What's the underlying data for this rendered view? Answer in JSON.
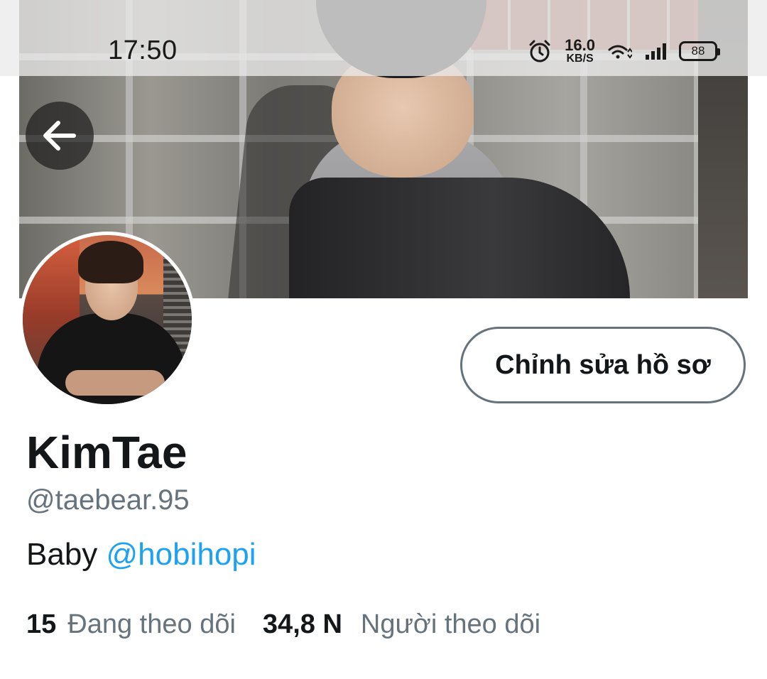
{
  "status_bar": {
    "time": "17:50",
    "net_speed_value": "16.0",
    "net_speed_unit": "KB/S",
    "battery": "88",
    "icons": [
      "alarm-icon",
      "wifi-icon",
      "signal-icon",
      "battery-icon"
    ]
  },
  "header": {
    "back_icon": "arrow-left-icon"
  },
  "profile": {
    "edit_button_label": "Chỉnh sửa hồ sơ",
    "display_name": "KimTae",
    "username": "@taebear.95",
    "bio_text": "Baby ",
    "bio_mention": "@hobihopi"
  },
  "stats": {
    "following_count": "15",
    "following_label": "Đang theo dõi",
    "followers_count": "34,8 N",
    "followers_label": "Người theo dõi"
  },
  "colors": {
    "text_primary": "#14171a",
    "text_secondary": "#66727c",
    "link": "#1da1f2",
    "button_border": "#66727c"
  }
}
